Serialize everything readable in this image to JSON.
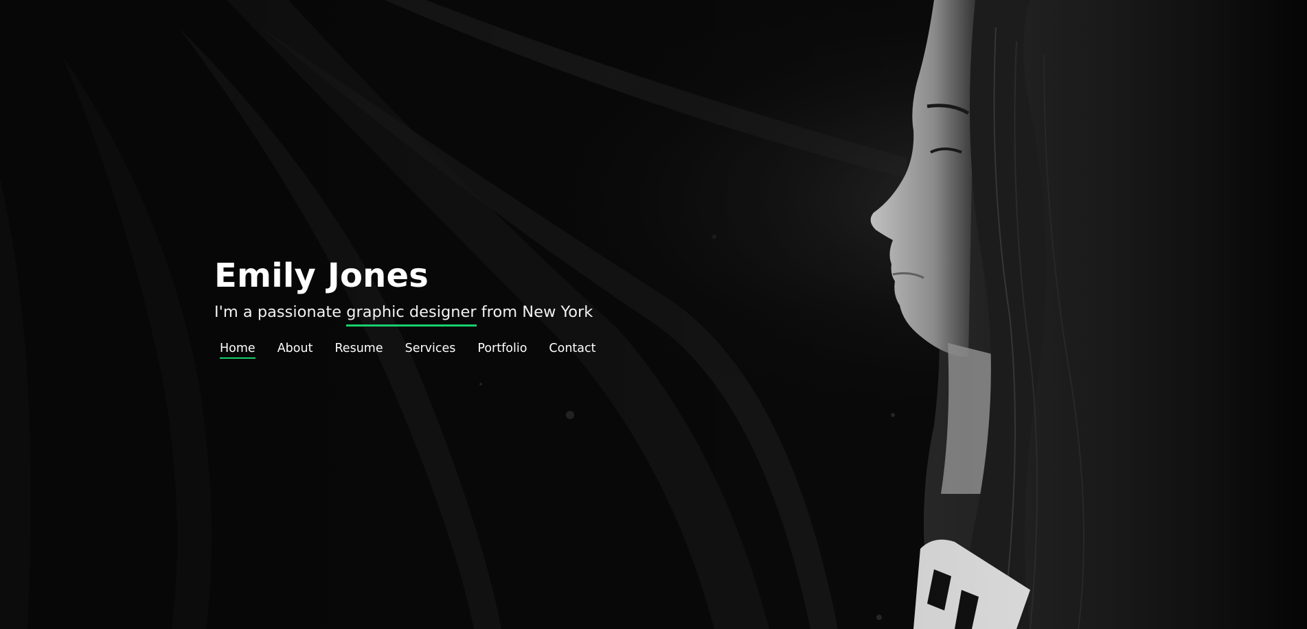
{
  "hero": {
    "name": "Emily Jones",
    "tagline_prefix": "I'm a passionate ",
    "tagline_typed": "graphic designer",
    "tagline_suffix": " from New York",
    "background_image": "portrait-photo"
  },
  "nav": {
    "items": [
      {
        "label": "Home",
        "active": true
      },
      {
        "label": "About",
        "active": false
      },
      {
        "label": "Resume",
        "active": false
      },
      {
        "label": "Services",
        "active": false
      },
      {
        "label": "Portfolio",
        "active": false
      },
      {
        "label": "Contact",
        "active": false
      }
    ]
  },
  "colors": {
    "accent": "#18d26e",
    "background": "#0b0b0b",
    "text": "#ffffff"
  }
}
